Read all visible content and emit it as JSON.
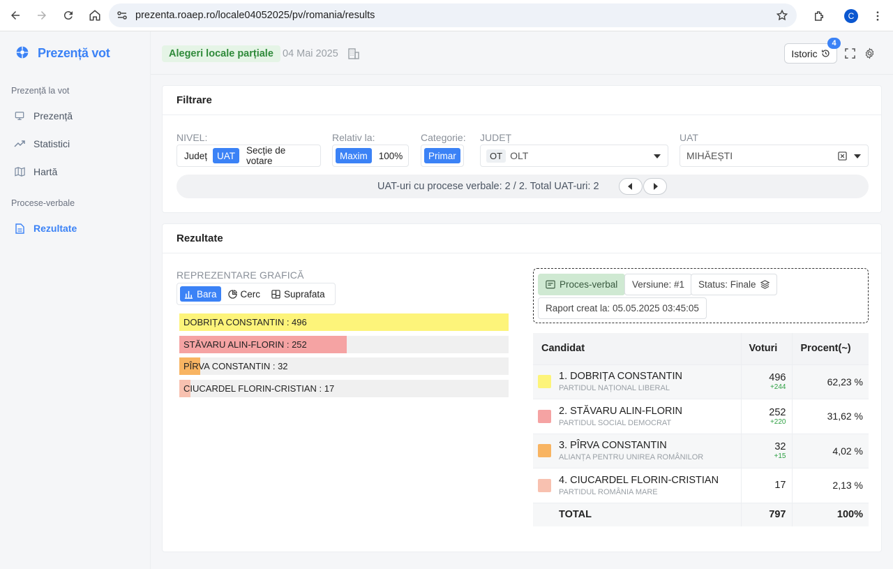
{
  "browser": {
    "url": "prezenta.roaep.ro/locale04052025/pv/romania/results",
    "profile_initial": "C"
  },
  "sidebar": {
    "brand": "Prezență vot",
    "section1": "Prezență la vot",
    "items": [
      {
        "label": "Prezență"
      },
      {
        "label": "Statistici"
      },
      {
        "label": "Hartă"
      }
    ],
    "section2": "Procese-verbale",
    "results_item": "Rezultate"
  },
  "header": {
    "election": "Alegeri locale parțiale",
    "date": "04 Mai 2025",
    "history_label": "Istoric",
    "history_count": "4"
  },
  "filter": {
    "title": "Filtrare",
    "nivel_label": "NIVEL:",
    "nivel_options": [
      "Județ",
      "UAT",
      "Secție de votare"
    ],
    "relativ_label": "Relativ la:",
    "relativ_options": [
      "Maxim",
      "100%"
    ],
    "categorie_label": "Categorie:",
    "categorie_value": "Primar",
    "judet_label": "JUDEȚ",
    "judet_code": "OT",
    "judet_value": "OLT",
    "uat_label": "UAT",
    "uat_value": "MIHĂEȘTI",
    "info": "UAT-uri cu procese verbale: 2 / 2. Total UAT-uri: 2"
  },
  "results": {
    "title": "Rezultate",
    "repr_label": "REPREZENTARE GRAFICĂ",
    "chart_tabs": [
      "Bara",
      "Cerc",
      "Suprafata"
    ],
    "pv_label": "Proces-verbal",
    "version": "Versiune: #1",
    "status": "Status: Finale",
    "report_created": "Raport creat la: 05.05.2025 03:45:05",
    "table_headers": [
      "Candidat",
      "Voturi",
      "Procent(~)"
    ],
    "candidates": [
      {
        "name": "1. DOBRIȚA CONSTANTIN",
        "party": "PARTIDUL NAȚIONAL LIBERAL",
        "votes": "496",
        "delta": "+244",
        "percent": "62,23 %",
        "color": "#fdf47a"
      },
      {
        "name": "2. STĂVARU ALIN-FLORIN",
        "party": "PARTIDUL SOCIAL DEMOCRAT",
        "votes": "252",
        "delta": "+220",
        "percent": "31,62 %",
        "color": "#f5a3a3"
      },
      {
        "name": "3. PÎRVA CONSTANTIN",
        "party": "ALIANȚA PENTRU UNIREA ROMÂNILOR",
        "votes": "32",
        "delta": "+15",
        "percent": "4,02 %",
        "color": "#f8b462"
      },
      {
        "name": "4. CIUCARDEL FLORIN-CRISTIAN",
        "party": "PARTIDUL ROMÂNIA MARE",
        "votes": "17",
        "delta": "",
        "percent": "2,13 %",
        "color": "#f8c1b0"
      }
    ],
    "total_label": "TOTAL",
    "total_votes": "797",
    "total_percent": "100%"
  },
  "chart_data": {
    "type": "bar",
    "orientation": "horizontal",
    "categories": [
      "DOBRIȚA CONSTANTIN",
      "STĂVARU ALIN-FLORIN",
      "PÎRVA CONSTANTIN",
      "CIUCARDEL FLORIN-CRISTIAN"
    ],
    "values": [
      496,
      252,
      32,
      17
    ],
    "bar_labels": [
      "DOBRIȚA CONSTANTIN : 496",
      "STĂVARU ALIN-FLORIN : 252",
      "PÎRVA CONSTANTIN : 32",
      "CIUCARDEL FLORIN-CRISTIAN : 17"
    ],
    "colors": [
      "#fdf47a",
      "#f5a3a3",
      "#f8b462",
      "#f8c1b0"
    ],
    "scale": "relative to maximum",
    "title": "",
    "xlabel": "",
    "ylabel": ""
  }
}
